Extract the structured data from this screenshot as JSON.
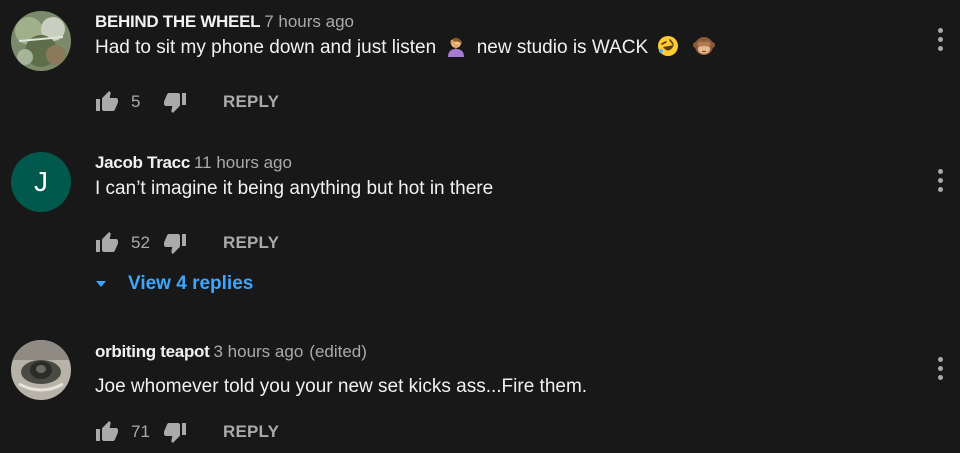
{
  "comments": [
    {
      "author": "BEHIND THE WHEEL",
      "time": "7 hours ago",
      "text_before": "Had to sit my phone down and just listen",
      "emoji_1": "woman-facepalming-emoji",
      "text_middle": "new studio is WACK",
      "emoji_2": "rolling-laughing-emoji",
      "emoji_3": "see-no-evil-monkey-emoji",
      "likes": "5",
      "reply_label": "REPLY",
      "avatar": "photo-avatar"
    },
    {
      "author": "Jacob Tracc",
      "time": "11 hours ago",
      "avatar_letter": "J",
      "text": "I can’t imagine it being anything but hot in there",
      "likes": "52",
      "reply_label": "REPLY",
      "view_replies": "View 4 replies",
      "colors": {
        "avatar_bg": "#00594c"
      }
    },
    {
      "author": "orbiting teapot",
      "time": "3 hours ago",
      "edited": "(edited)",
      "text": "Joe whomever told you your new set kicks ass...Fire them.",
      "likes": "71",
      "reply_label": "REPLY",
      "avatar": "photo-avatar"
    }
  ],
  "colors": {
    "background": "#181818",
    "primary_text": "#f1f1f1",
    "secondary_text": "#aaaaaa",
    "link": "#3ea6ff"
  },
  "icons": {
    "like": "thumbs-up-icon",
    "dislike": "thumbs-down-icon",
    "menu": "more-vertical-icon",
    "expand": "caret-down-icon"
  }
}
